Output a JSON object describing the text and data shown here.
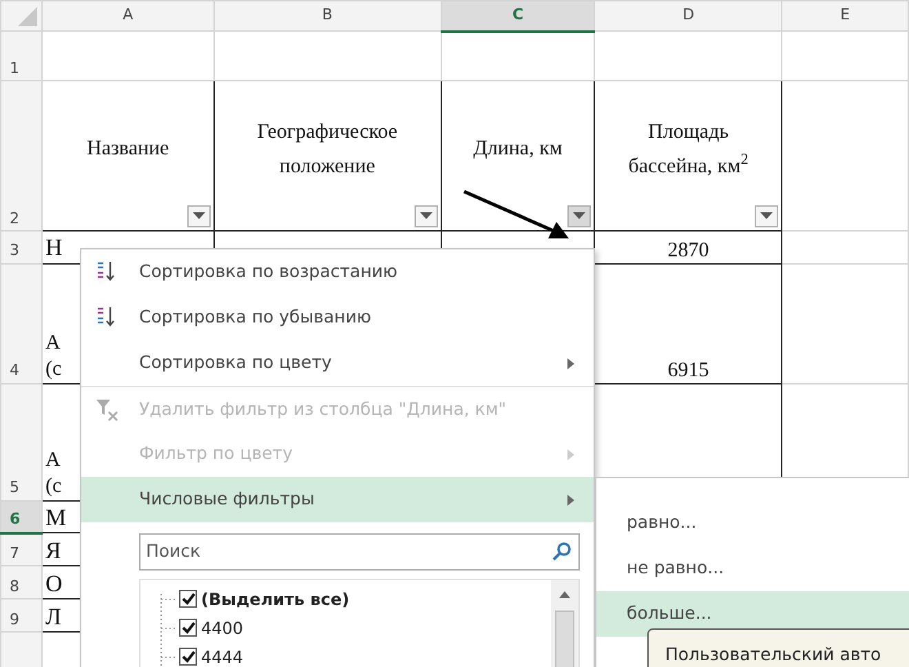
{
  "columns": [
    {
      "label": "A",
      "selected": false
    },
    {
      "label": "B",
      "selected": false
    },
    {
      "label": "C",
      "selected": true
    },
    {
      "label": "D",
      "selected": false
    },
    {
      "label": "E",
      "selected": false
    }
  ],
  "rows": [
    {
      "label": "1",
      "selected": false,
      "cells": {}
    },
    {
      "label": "2",
      "selected": false,
      "cells": {
        "A": {
          "lines": [
            "Название"
          ],
          "filter": true,
          "active": false
        },
        "B": {
          "lines": [
            "Географическое",
            "положение"
          ],
          "filter": true,
          "active": false
        },
        "C": {
          "lines": [
            "Длина, км"
          ],
          "filter": true,
          "active": true
        },
        "D": {
          "lines": [
            "Площадь",
            "бассейна, км$^{2}$"
          ],
          "filter": true,
          "active": false
        }
      }
    },
    {
      "label": "3",
      "selected": false,
      "cells": {
        "A": {
          "lines": [
            "Н"
          ]
        },
        "D": {
          "lines": [
            "2870"
          ]
        }
      }
    },
    {
      "label": "4",
      "selected": false,
      "cells": {
        "A": {
          "lines": [
            "А",
            "(с"
          ]
        },
        "D": {
          "lines": [
            "6915"
          ]
        }
      }
    },
    {
      "label": "5",
      "selected": false,
      "cells": {
        "A": {
          "lines": [
            "А",
            "(с"
          ]
        }
      }
    },
    {
      "label": "6",
      "selected": true,
      "cells": {
        "A": {
          "lines": [
            "М"
          ]
        }
      }
    },
    {
      "label": "7",
      "selected": false,
      "cells": {
        "A": {
          "lines": [
            "Я"
          ]
        }
      }
    },
    {
      "label": "8",
      "selected": false,
      "cells": {
        "A": {
          "lines": [
            "О"
          ]
        }
      }
    },
    {
      "label": "9",
      "selected": false,
      "cells": {
        "A": {
          "lines": [
            "Л"
          ]
        }
      }
    }
  ],
  "filter_menu": {
    "items": [
      {
        "kind": "sort-asc",
        "label": "Сортировка по возрастанию",
        "disabled": false,
        "selected": false,
        "submenu": false
      },
      {
        "kind": "sort-desc",
        "label": "Сортировка по убыванию",
        "disabled": false,
        "selected": false,
        "submenu": false
      },
      {
        "kind": "plain",
        "label": "Сортировка по цвету",
        "disabled": false,
        "selected": false,
        "submenu": true
      },
      {
        "kind": "clear-filter",
        "label": "Удалить фильтр из столбца \"Длина, км\"",
        "disabled": true,
        "selected": false,
        "submenu": false,
        "separator_before": true
      },
      {
        "kind": "plain",
        "label": "Фильтр по цвету",
        "disabled": true,
        "selected": false,
        "submenu": true
      },
      {
        "kind": "plain",
        "label": "Числовые фильтры",
        "disabled": false,
        "selected": true,
        "submenu": true
      }
    ],
    "search": {
      "placeholder": "Поиск"
    },
    "values": [
      {
        "label": "(Выделить все)",
        "checked": true,
        "kind": "all"
      },
      {
        "label": "4400",
        "checked": true,
        "kind": "value"
      },
      {
        "label": "4444",
        "checked": true,
        "kind": "value"
      }
    ]
  },
  "submenu": {
    "items": [
      {
        "label": "равно...",
        "selected": false
      },
      {
        "label": "не равно...",
        "selected": false
      },
      {
        "label": "больше...",
        "selected": true
      }
    ]
  },
  "tooltip": {
    "text": "Пользовательский авто"
  }
}
